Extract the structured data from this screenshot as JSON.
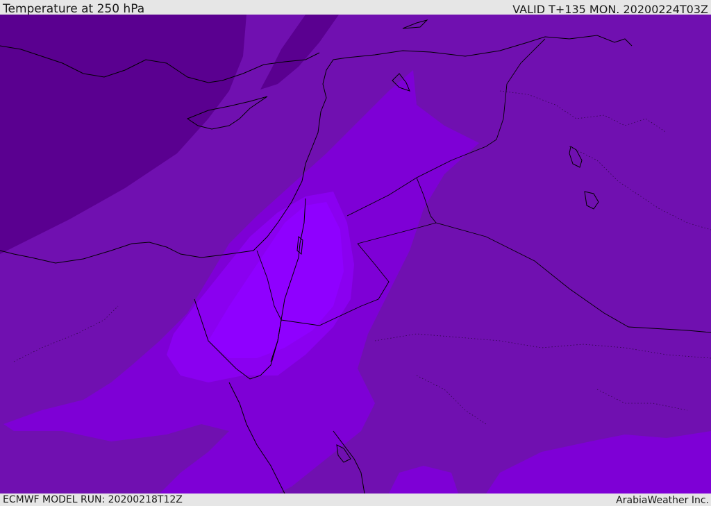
{
  "header": {
    "title": "Temperature at 250 hPa",
    "valid_time": "VALID T+135 MON. 20200224T03Z"
  },
  "footer": {
    "model_run": "ECMWF MODEL RUN: 20200218T12Z",
    "credit": "ArabiaWeather Inc."
  },
  "map": {
    "field": "temperature",
    "level": "250 hPa",
    "palette": {
      "coldest": "#5a0090",
      "cold": "#7010b0",
      "mid": "#7e00d6",
      "warm": "#8a00f0",
      "warmest": "#8f00ff",
      "coastline": "#000000"
    }
  }
}
